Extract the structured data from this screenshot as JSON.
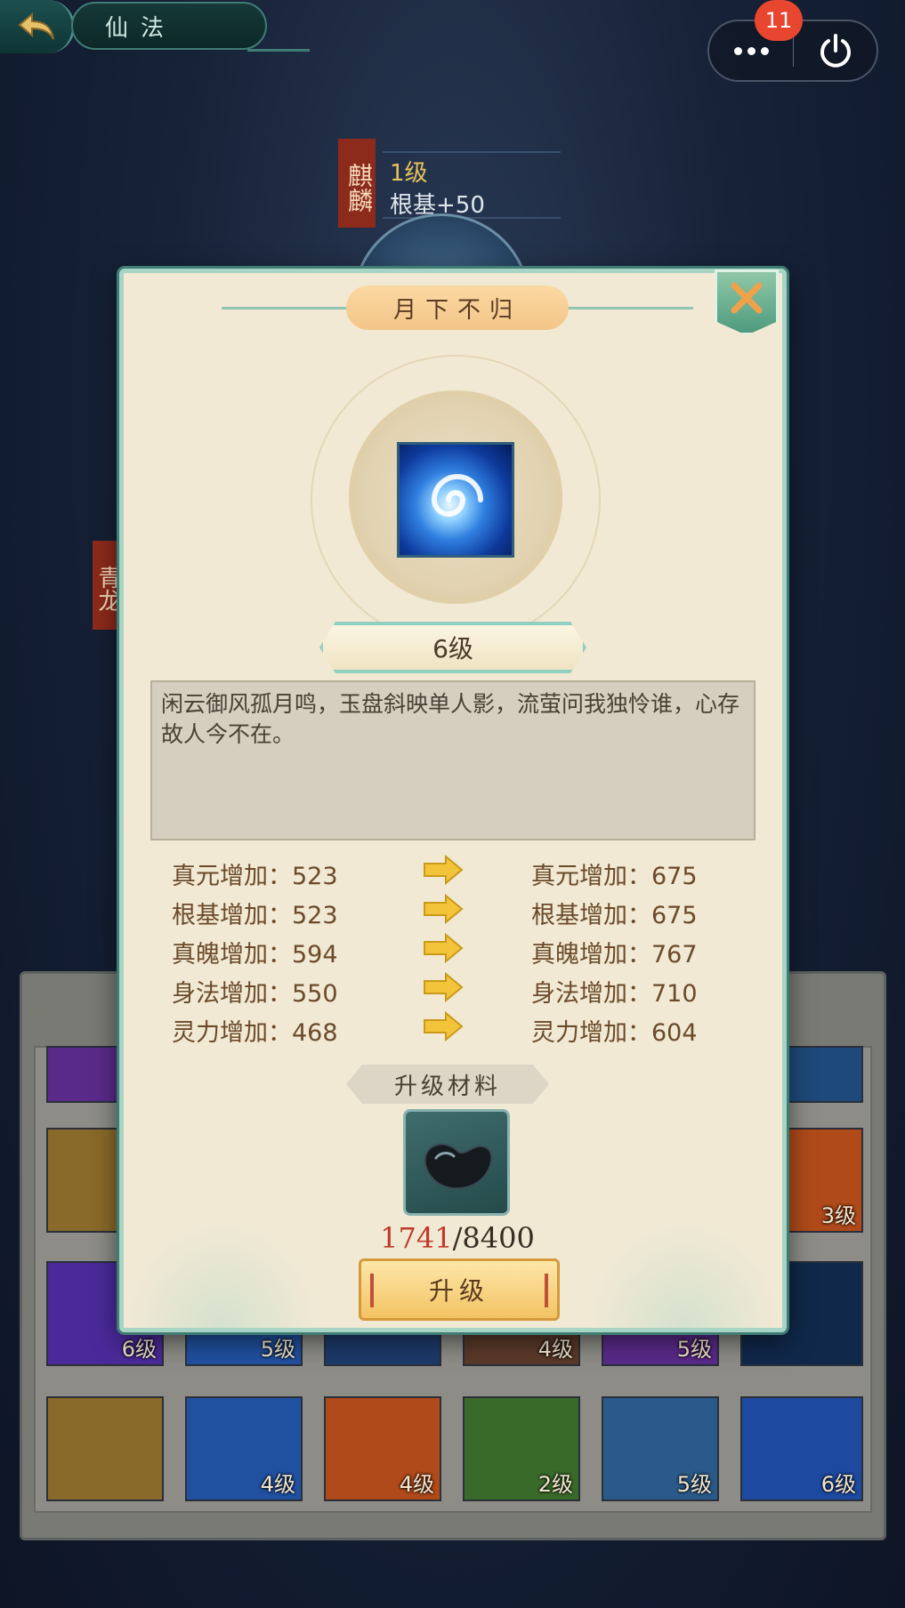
{
  "header": {
    "title": "仙法",
    "notification_count": "11"
  },
  "beast": {
    "name": "麒麟",
    "level": "1级",
    "stat": "根基+50"
  },
  "side_tag": "青龙",
  "skill_dialog": {
    "title": "月下不归",
    "level": "6级",
    "description": "闲云御风孤月鸣，玉盘斜映单人影，流萤问我独怜谁，心存故人今不在。",
    "stats": [
      {
        "current": "真元增加：523",
        "next": "真元增加：675"
      },
      {
        "current": "根基增加：523",
        "next": "根基增加：675"
      },
      {
        "current": "真魄增加：594",
        "next": "真魄增加：767"
      },
      {
        "current": "身法增加：550",
        "next": "身法增加：710"
      },
      {
        "current": "灵力增加：468",
        "next": "灵力增加：604"
      }
    ],
    "material_label": "升级材料",
    "material_have": "1741",
    "material_need": "/8400",
    "upgrade_label": "升级"
  },
  "grid_tiles": [
    {
      "label": "",
      "color": "#5a2a8a"
    },
    {
      "label": "",
      "color": "#1d4a7a"
    },
    {
      "label": "6级",
      "color": "#4a2a9a"
    },
    {
      "label": "5级",
      "color": "#2050a0"
    },
    {
      "label": "4级",
      "color": "#5a3a2a"
    },
    {
      "label": "5级",
      "color": "#5a2a8a"
    },
    {
      "label": "",
      "color": "#1d3a6a"
    },
    {
      "label": "4级",
      "color": "#2050a0"
    },
    {
      "label": "4级",
      "color": "#b04a1a"
    },
    {
      "label": "2级",
      "color": "#3a6a2a"
    },
    {
      "label": "5级",
      "color": "#2a5a8a"
    },
    {
      "label": "6级",
      "color": "#1d4aa0"
    },
    {
      "label": "",
      "color": "#8a6a2a"
    },
    {
      "label": "3级",
      "color": "#b04a1a"
    }
  ]
}
